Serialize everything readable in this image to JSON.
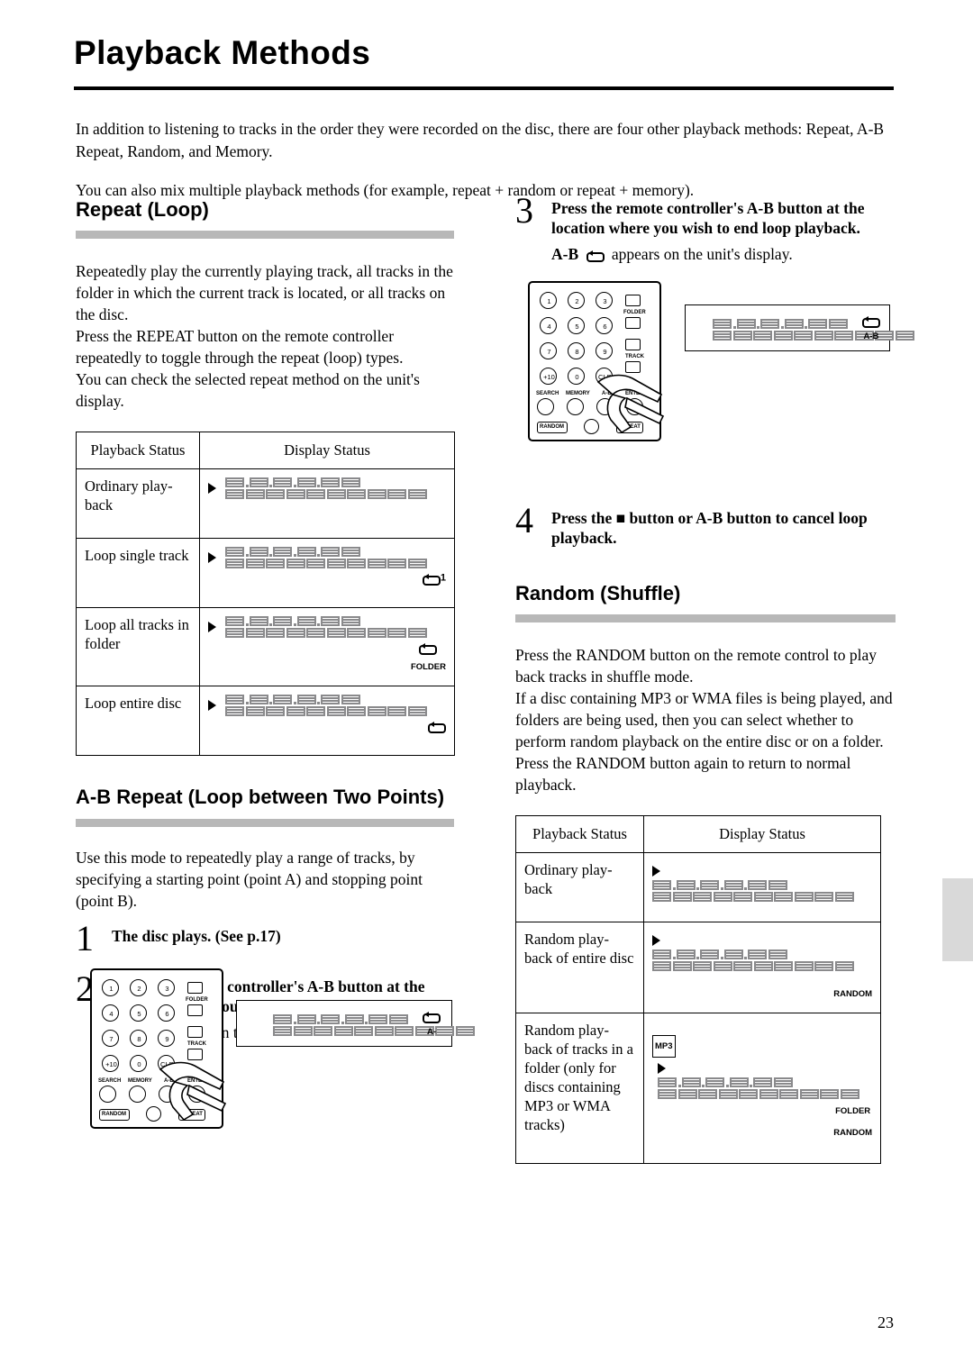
{
  "page": {
    "title": "Playback Methods",
    "number": "23"
  },
  "intro": {
    "paragraph1": "In addition to listening to tracks in the order they were recorded on the disc, there are four other playback methods: Repeat, A-B Repeat, Random, and Memory.",
    "paragraph2": "You can also mix multiple playback methods (for example, repeat + random or repeat + memory)."
  },
  "repeat_section": {
    "heading": "Repeat (Loop)",
    "body": "Repeatedly play the currently playing track, all tracks in the folder in which the current track is located, or all tracks on the disc.\nPress the REPEAT button on the remote controller repeatedly to toggle through the repeat (loop) types.\nYou can check the selected repeat method on the unit's display.",
    "table": {
      "headers": [
        "Playback Status",
        "Display Status"
      ],
      "rows": [
        {
          "status": "Ordinary play-back",
          "icon": "",
          "icon_label": ""
        },
        {
          "status": "Loop single track",
          "icon": "loop-icon",
          "icon_label": "1"
        },
        {
          "status": "Loop all tracks in folder",
          "icon": "loop-icon",
          "icon_label": "FOLDER"
        },
        {
          "status": "Loop entire disc",
          "icon": "loop-icon",
          "icon_label": ""
        }
      ]
    }
  },
  "ab_section": {
    "heading": "A-B Repeat (Loop between Two Points)",
    "body": "Use this mode to repeatedly play a range of tracks, by specifying a starting point (point A) and stopping point (point B).",
    "steps": [
      {
        "num": "1",
        "text": "The disc plays. (See p.17)",
        "sub": ""
      },
      {
        "num": "2",
        "text": "Press the remote controller's A-B button at the location where you wish to start loop playback.",
        "sub": "A- ↺ appears on the unit's display.",
        "sub_prefix": "A-",
        "sub_suffix": "appears on the unit's display."
      },
      {
        "num": "3",
        "text": "Press the remote controller's A-B button at the location where you wish to end loop playback.",
        "sub_prefix": "A-B",
        "sub_suffix": "appears on the unit's display."
      },
      {
        "num": "4",
        "text": "Press the ■ button or A-B button to cancel loop playback.",
        "sub_prefix": "",
        "sub_suffix": ""
      }
    ],
    "display_tag_a": "A-",
    "display_tag_ab": "A-B"
  },
  "random_section": {
    "heading": "Random (Shuffle)",
    "body": "Press the RANDOM button on the remote control to play back tracks in shuffle mode.\nIf a disc containing MP3 or WMA files is being played, and folders are being used, then you can select whether to perform random playback on the entire disc or on a folder.\nPress the RANDOM button again to return to normal playback.",
    "table": {
      "headers": [
        "Playback Status",
        "Display Status"
      ],
      "rows": [
        {
          "status": "Ordinary play-back",
          "left_tag": "",
          "tags": []
        },
        {
          "status": "Random play-back of entire disc",
          "left_tag": "",
          "tags": [
            "RANDOM"
          ]
        },
        {
          "status": "Random play-back of tracks in a folder (only for discs containing MP3 or WMA tracks)",
          "left_tag": "MP3",
          "tags": [
            "FOLDER",
            "RANDOM"
          ]
        }
      ]
    }
  },
  "remote": {
    "numbers": [
      "1",
      "2",
      "3",
      "4",
      "5",
      "6",
      "7",
      "8",
      "9",
      "+10",
      "0",
      "CLR"
    ],
    "side_labels": [
      "FOLDER",
      "TRACK"
    ],
    "row_labels": [
      "SEARCH",
      "MEMORY",
      "A-B",
      "ENTER"
    ],
    "bottom_labels": [
      "RANDOM",
      "REPEAT"
    ]
  }
}
